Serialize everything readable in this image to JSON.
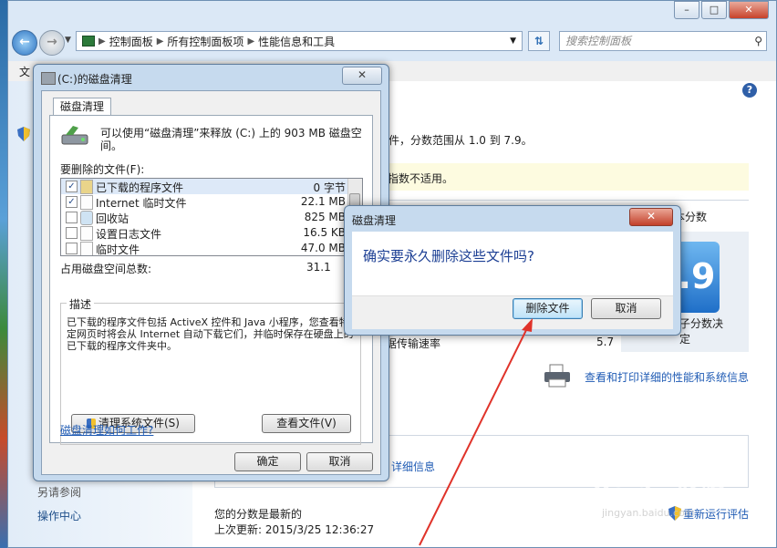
{
  "explorer": {
    "breadcrumb": [
      "控制面板",
      "所有控制面板项",
      "性能信息和工具"
    ],
    "search_placeholder": "搜索控制面板",
    "menu_first": "文",
    "left_links": [
      "另请参阅",
      "操作中心"
    ],
    "right": {
      "score_line": "件，分数范围从 1.0 到 7.9。",
      "notice": "指数不适用。",
      "subscore_header": "本分数",
      "score_value": ".9",
      "subscore_label_1": "子分数决",
      "subscore_label_2": "定",
      "disk_row_label": "据传输速率",
      "disk_row_value": "5.7",
      "print_link": "查看和打印详细的性能和系统信息",
      "detail_link": "详细信息",
      "status_1": "您的分数是最新的",
      "status_2": "上次更新: 2015/3/25 12:36:27",
      "rerun_link": "重新运行评估"
    }
  },
  "cleanup": {
    "title": "(C:)的磁盘清理",
    "tab": "磁盘清理",
    "intro": "可以使用“磁盘清理”来释放  (C:) 上的 903 MB 磁盘空间。",
    "files_label": "要删除的文件(F):",
    "files": [
      {
        "name": "已下载的程序文件",
        "size": "0 字节",
        "checked": true,
        "selected": true
      },
      {
        "name": "Internet 临时文件",
        "size": "22.1 MB",
        "checked": true,
        "selected": false
      },
      {
        "name": "回收站",
        "size": "825 MB",
        "checked": false,
        "selected": false
      },
      {
        "name": "设置日志文件",
        "size": "16.5 KB",
        "checked": false,
        "selected": false
      },
      {
        "name": "临时文件",
        "size": "47.0 MB",
        "checked": false,
        "selected": false
      }
    ],
    "total_label": "占用磁盘空间总数:",
    "total_value": "31.1 ",
    "desc_label": "描述",
    "desc_text": "已下载的程序文件包括 ActiveX 控件和 Java 小程序，您查看特定网页时将会从 Internet 自动下载它们，并临时保存在硬盘上的已下载的程序文件夹中。",
    "clean_system_button": "清理系统文件(S)",
    "view_files_button": "查看文件(V)",
    "how_link": "磁盘清理如何工作?",
    "ok_button": "确定",
    "cancel_button": "取消"
  },
  "confirm": {
    "title": "磁盘清理",
    "message": "确实要永久删除这些文件吗?",
    "delete_button": "删除文件",
    "cancel_button": "取消"
  },
  "watermark": {
    "brand": "Baidu 经验",
    "site": "jingyan.baidu.com"
  },
  "colors": {
    "accent": "#1f5bb4",
    "title_bar": "#c6daee",
    "annotation_arrow": "#e0332a"
  }
}
